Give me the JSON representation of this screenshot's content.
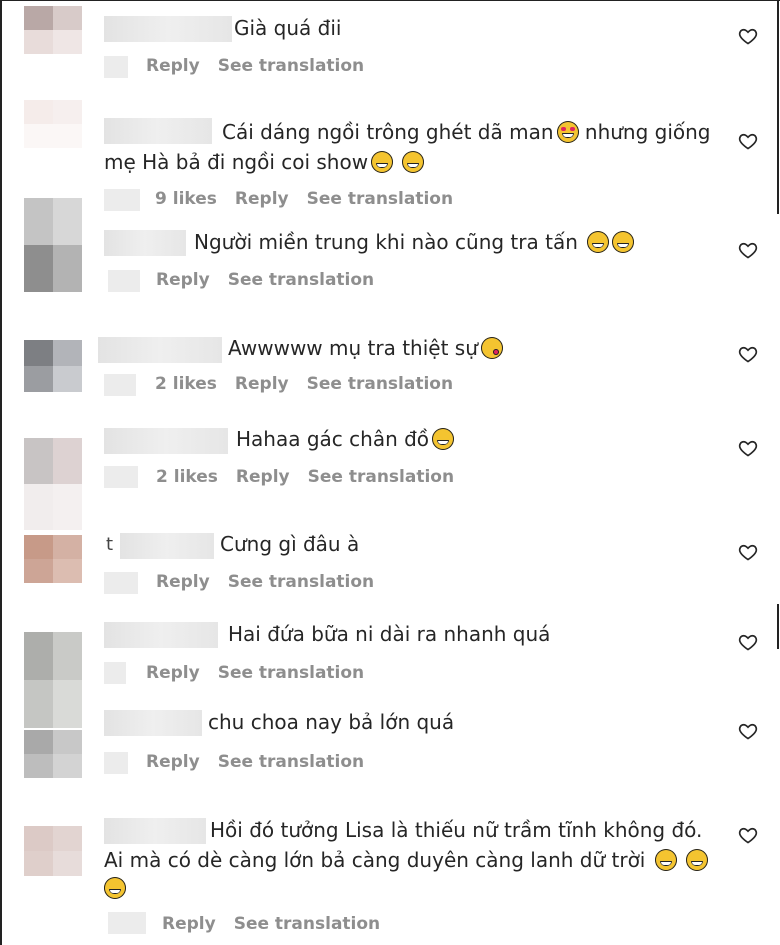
{
  "comments": [
    {
      "text": "Già quá đii",
      "likes": "",
      "reply": "Reply",
      "translate": "See translation",
      "lead": ""
    },
    {
      "text": "Cái dáng ngồi trông ghét dã man",
      "text_line2": "mẹ Hà bả đi ngồi coi show",
      "suffix1": " nhưng giống",
      "likes": "9 likes",
      "reply": "Reply",
      "translate": "See translation"
    },
    {
      "text": "Người miền trung khi nào cũng tra tấn",
      "likes": "",
      "reply": "Reply",
      "translate": "See translation"
    },
    {
      "text": "Awwwww mụ tra thiệt sự",
      "likes": "2 likes",
      "reply": "Reply",
      "translate": "See translation"
    },
    {
      "text": "Hahaa gác chân đồ",
      "likes": "2 likes",
      "reply": "Reply",
      "translate": "See translation"
    },
    {
      "text": "Cưng gì đâu à",
      "likes": "",
      "reply": "Reply",
      "translate": "See translation",
      "lead": "t"
    },
    {
      "text": "Hai đứa bữa ni dài ra nhanh quá",
      "likes": "",
      "reply": "Reply",
      "translate": "See translation"
    },
    {
      "text": "chu choa nay bả lớn quá",
      "likes": "",
      "reply": "Reply",
      "translate": "See translation"
    },
    {
      "text": "Hồi đó tưởng Lisa là thiếu nữ trầm tĩnh không đó.",
      "text_line2": "Ai mà có dè càng lớn bả càng duyên càng lanh dữ trời",
      "likes": "",
      "reply": "Reply",
      "translate": "See translation"
    }
  ],
  "icons": {
    "heart": "heart-outline-icon",
    "laugh": "face-with-tears-of-joy-icon",
    "rofl": "rolling-on-floor-laughing-icon",
    "heart_eyes": "smiling-face-with-heart-eyes-icon",
    "wink": "face-blowing-a-kiss-icon"
  },
  "colors": {
    "text": "#262626",
    "meta": "#8e8e8e",
    "background": "#ffffff"
  }
}
